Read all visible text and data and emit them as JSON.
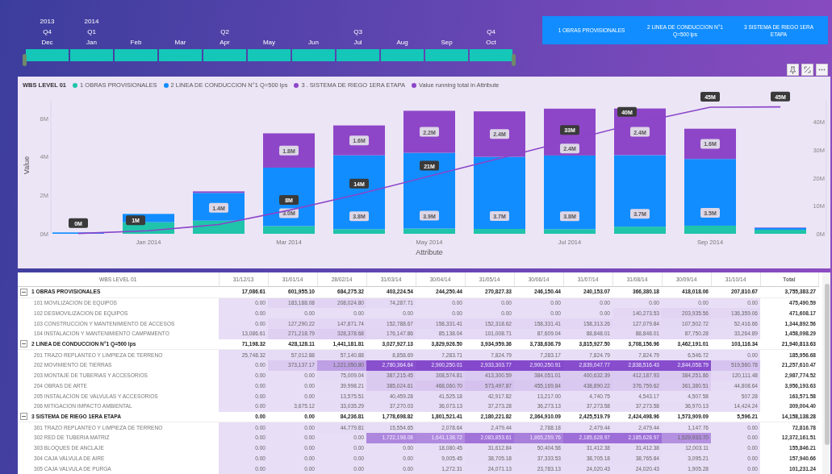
{
  "timeline": {
    "periods": [
      {
        "year": "2013",
        "quarter": "Q4",
        "month": "Dec",
        "selected": true
      },
      {
        "year": "2014",
        "quarter": "Q1",
        "month": "Jan",
        "selected": true
      },
      {
        "month": "Feb",
        "selected": true
      },
      {
        "month": "Mar",
        "selected": true
      },
      {
        "quarter": "Q2",
        "month": "Apr",
        "selected": true
      },
      {
        "month": "May",
        "selected": true
      },
      {
        "month": "Jun",
        "selected": true
      },
      {
        "quarter": "Q3",
        "month": "Jul",
        "selected": true
      },
      {
        "month": "Aug",
        "selected": true
      },
      {
        "month": "Sep",
        "selected": true
      },
      {
        "quarter": "Q4",
        "month": "Oct",
        "selected": true
      }
    ]
  },
  "filter_buttons": [
    {
      "label": "1 OBRAS PROVISIONALES",
      "selected": false
    },
    {
      "label": "2 LINEA DE CONDUCCION N°1 Q=500 lps",
      "selected": false
    },
    {
      "label": "3 SISTEMA DE RIEGO 1ERA ETAPA",
      "selected": false
    }
  ],
  "chart_panel": {
    "legend_title": "WBS LEVEL 01",
    "chart_data": {
      "type": "bar",
      "stacked": true,
      "xlabel": "Attribute",
      "ylabel": "Value",
      "categories": [
        null,
        "Jan 2014",
        null,
        "Mar 2014",
        null,
        "May 2014",
        null,
        "Jul 2014",
        null,
        "Sep 2014",
        null
      ],
      "ylim": [
        0,
        6.9
      ],
      "yticks": [
        {
          "value": 0,
          "label": "0M"
        },
        {
          "value": 2,
          "label": "2M"
        },
        {
          "value": 4,
          "label": "4M"
        },
        {
          "value": 6,
          "label": "6M"
        }
      ],
      "series": [
        {
          "name": "1 OBRAS PROVISIONALES",
          "color": "#1fc4aa",
          "values": [
            null,
            0.6,
            0.68,
            0.4,
            0.24,
            0.27,
            0.25,
            0.24,
            0.37,
            0.42,
            0.21
          ]
        },
        {
          "name": "2 LINEA DE CONDUCCION N°1 Q=500 lps",
          "color": "#118dff",
          "values": [
            0.07,
            0.43,
            1.44,
            3.03,
            3.83,
            3.93,
            3.74,
            3.82,
            3.71,
            3.46,
            0.1
          ],
          "value_labels": [
            null,
            null,
            "1.4M",
            "3.0M",
            "3.8M",
            "3.9M",
            "3.7M",
            "3.8M",
            "3.7M",
            "3.5M",
            null
          ]
        },
        {
          "name": "3 . SISTEMA DE RIEGO 1ERA ETAPA",
          "color": "#8e46c8",
          "values": [
            0,
            0,
            0.08,
            1.78,
            1.55,
            2.18,
            2.36,
            2.43,
            2.42,
            1.57,
            0.01
          ],
          "value_labels": [
            null,
            null,
            null,
            "1.8M",
            "1.6M",
            "2.2M",
            "2.4M",
            "2.4M",
            "2.4M",
            "1.6M",
            null
          ]
        }
      ]
    },
    "line_overlay": {
      "chart_data": {
        "type": "line",
        "categories": [
          null,
          null,
          null,
          null,
          null,
          null,
          null,
          null,
          null,
          null,
          null
        ],
        "ylim": [
          0,
          47.6
        ],
        "yticks": [
          {
            "value": 0,
            "label": "0M"
          },
          {
            "value": 10,
            "label": "10M"
          },
          {
            "value": 20,
            "label": "20M"
          },
          {
            "value": 30,
            "label": "30M"
          },
          {
            "value": 40,
            "label": "40M"
          }
        ],
        "series": [
          {
            "name": "Value running total in Attribute",
            "color": "#8a45c9",
            "values": [
              0.1,
              1.1,
              3.3,
              8.4,
              14.2,
              20.6,
              27,
              33.4,
              39.9,
              45.3,
              45.4
            ],
            "value_labels": [
              "0M",
              "1M",
              null,
              "8M",
              "14M",
              "21M",
              null,
              "33M",
              "40M",
              "45M",
              "45M"
            ]
          }
        ]
      }
    }
  },
  "table": {
    "columns": [
      "WBS LEVEL 01",
      "31/12/13",
      "31/01/14",
      "28/02/14",
      "31/03/14",
      "30/04/14",
      "31/05/14",
      "30/06/14",
      "31/07/14",
      "31/08/14",
      "30/09/14",
      "31/10/14",
      "Total"
    ],
    "rows": [
      {
        "label": "1 OBRAS PROVISIONALES",
        "expanded": true,
        "values": [
          "17,086.61",
          "601,955.10",
          "684,275.32",
          "403,224.54",
          "244,250.44",
          "270,827.33",
          "246,150.44",
          "240,153.07",
          "366,380.18",
          "418,018.06",
          "207,810.67"
        ],
        "total": "3,755,383.27",
        "children": [
          {
            "label": "101 MOVILIZACION DE EQUIPOS",
            "values": [
              "0.00",
              "183,188.08",
              "208,024.80",
              "74,287.71",
              "0.00",
              "0.00",
              "0.00",
              "0.00",
              "0.00",
              "0.00",
              "0.00"
            ],
            "total": "475,490.59"
          },
          {
            "label": "102 DESMOVILIZACION DE EQUIPOS",
            "values": [
              "0.00",
              "0.00",
              "0.00",
              "0.00",
              "0.00",
              "0.00",
              "0.00",
              "0.00",
              "140,273.53",
              "203,935.56",
              "136,359.06"
            ],
            "total": "471,608.17"
          },
          {
            "label": "103 CONSTRUCCION Y MANTENIMIENTO DE ACCESOS",
            "values": [
              "0.00",
              "127,290.22",
              "147,871.74",
              "152,788.67",
              "158,331.41",
              "152,318.62",
              "158,331.41",
              "158,313.26",
              "127,079.84",
              "107,502.72",
              "52,416.66"
            ],
            "total": "1,344,892.56"
          },
          {
            "label": "104 INSTALACION Y MANTENIMIENTO CAMPAMENTO",
            "values": [
              "13,086.61",
              "271,218.79",
              "328,378.68",
              "176,147.86",
              "85,138.04",
              "101,008.71",
              "87,609.04",
              "88,848.01",
              "88,848.01",
              "87,750.28",
              "33,264.89"
            ],
            "total": "1,458,098.29"
          }
        ]
      },
      {
        "label": "2 LINEA DE CONDUCCION N°1 Q=500 lps",
        "expanded": true,
        "values": [
          "71,198.32",
          "428,128.11",
          "1,441,181.81",
          "3,027,927.13",
          "3,829,926.50",
          "3,934,959.36",
          "3,738,636.79",
          "3,815,927.50",
          "3,708,156.96",
          "3,462,191.01",
          "103,116.34"
        ],
        "total": "21,940,813.63",
        "children": [
          {
            "label": "201 TRAZO REPLANTEO Y LIMPIEZA DE TERRENO",
            "values": [
              "25,748.32",
              "57,012.88",
              "57,140.88",
              "8,858.69",
              "7,283.71",
              "7,824.79",
              "7,283.17",
              "7,824.79",
              "7,824.79",
              "6,546.72",
              "0.00"
            ],
            "total": "185,956.68"
          },
          {
            "label": "202 MOVIMIENTO DE TIERRAS",
            "values": [
              "0.00",
              "373,137.17",
              "1,221,050.80",
              "2,780,364.64",
              "2,900,250.01",
              "2,933,303.77",
              "2,900,250.91",
              "2,839,047.77",
              "2,838,516.43",
              "2,844,058.79",
              "519,560.78"
            ],
            "total": "21,257,610.47"
          },
          {
            "label": "203 MONTAJE DE TUBERIAS Y ACCESORIOS",
            "values": [
              "0.00",
              "0.00",
              "75,009.04",
              "387,215.45",
              "308,574.81",
              "413,300.59",
              "384,051.01",
              "400,632.39",
              "412,187.93",
              "384,251.86",
              "120,111.48"
            ],
            "total": "2,987,774.52"
          },
          {
            "label": "204 OBRAS DE ARTE",
            "values": [
              "0.00",
              "0.00",
              "39,998.21",
              "385,024.61",
              "468,060.70",
              "573,497.87",
              "455,169.84",
              "438,890.22",
              "376,759.62",
              "361,380.51",
              "44,808.64"
            ],
            "total": "3,956,193.63"
          },
          {
            "label": "205 INSTALACION DE VALVULAS Y ACCESORIOS",
            "values": [
              "0.00",
              "0.00",
              "13,575.51",
              "40,459.28",
              "41,525.18",
              "42,917.82",
              "13,217.00",
              "4,740.75",
              "4,543.17",
              "4,507.58",
              "507.28"
            ],
            "total": "163,571.58"
          },
          {
            "label": "206 MITIGACION IMPACTO AMBIENTAL",
            "values": [
              "0.00",
              "3,675.12",
              "33,035.29",
              "37,270.03",
              "36,073.13",
              "37,273.28",
              "36,273.13",
              "37,273.58",
              "37,273.58",
              "36,970.13",
              "14,424.24"
            ],
            "total": "309,004.40"
          }
        ]
      },
      {
        "label": "3 SISTEMA DE RIEGO 1ERA ETAPA",
        "expanded": true,
        "values": [
          "0.00",
          "0.00",
          "84,236.81",
          "1,778,698.82",
          "1,801,521.41",
          "2,180,221.82",
          "2,364,910.09",
          "2,425,519.79",
          "2,424,498.96",
          "1,573,909.09",
          "5,596.21"
        ],
        "total": "14,158,138.28",
        "children": [
          {
            "label": "301 TRAZO REPLANTEO Y LIMPIEZA DE TERRENO",
            "values": [
              "0.00",
              "0.00",
              "44,779.81",
              "15,554.65",
              "2,078.64",
              "2,479.44",
              "2,788.18",
              "2,479.44",
              "2,479.44",
              "1,147.76",
              "0.00"
            ],
            "total": "72,816.78"
          },
          {
            "label": "302 RED DE TUBERIA MATRIZ",
            "values": [
              "0.00",
              "0.00",
              "0.00",
              "1,722,198.08",
              "1,641,138.72",
              "2,083,853.61",
              "1,865,259.76",
              "2,185,628.97",
              "2,185,628.97",
              "1,529,933.70",
              "0.00"
            ],
            "total": "12,372,161.51"
          },
          {
            "label": "303 BLOQUES DE ANCLAJE",
            "values": [
              "0.00",
              "0.00",
              "0.00",
              "0.00",
              "18,080.45",
              "31,612.84",
              "50,404.58",
              "31,412.38",
              "31,412.38",
              "12,003.11",
              "0.00"
            ],
            "total": "155,846.21"
          },
          {
            "label": "304 CAJA VALVULA DE AIRE",
            "values": [
              "0.00",
              "0.00",
              "0.00",
              "0.00",
              "9,005.45",
              "38,705.18",
              "37,333.53",
              "38,705.18",
              "38,765.84",
              "3,095.21",
              "0.00"
            ],
            "total": "157,940.66"
          },
          {
            "label": "305 CAJA VALVULA DE PURGA",
            "values": [
              "0.00",
              "0.00",
              "0.00",
              "0.00",
              "1,272.31",
              "24,071.13",
              "23,783.13",
              "24,020.43",
              "24,020.43",
              "1,905.28",
              "0.00"
            ],
            "total": "101,231.24"
          }
        ]
      }
    ]
  }
}
